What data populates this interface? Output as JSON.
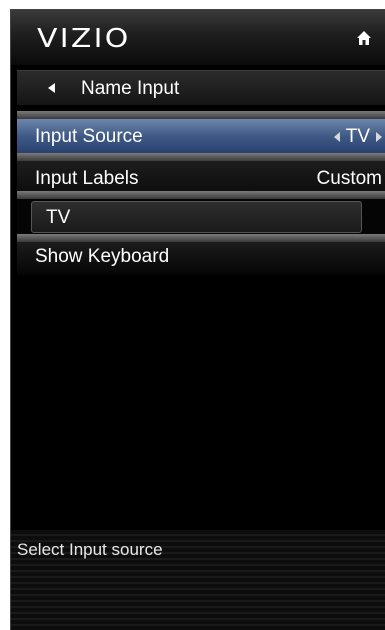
{
  "header": {
    "logo": "VIZIO",
    "home_icon": "home-icon"
  },
  "subheader": {
    "title": "Name Input",
    "back_icon": "back-arrow-icon"
  },
  "menu": {
    "input_source": {
      "label": "Input Source",
      "value": "TV"
    },
    "input_labels": {
      "label": "Input Labels",
      "value": "Custom"
    },
    "name_field": {
      "value": "TV"
    },
    "show_keyboard": {
      "label": "Show Keyboard"
    }
  },
  "footer": {
    "hint": "Select Input source"
  },
  "colors": {
    "selected_row": "#4a6590",
    "background": "#000000",
    "text": "#ffffff"
  }
}
